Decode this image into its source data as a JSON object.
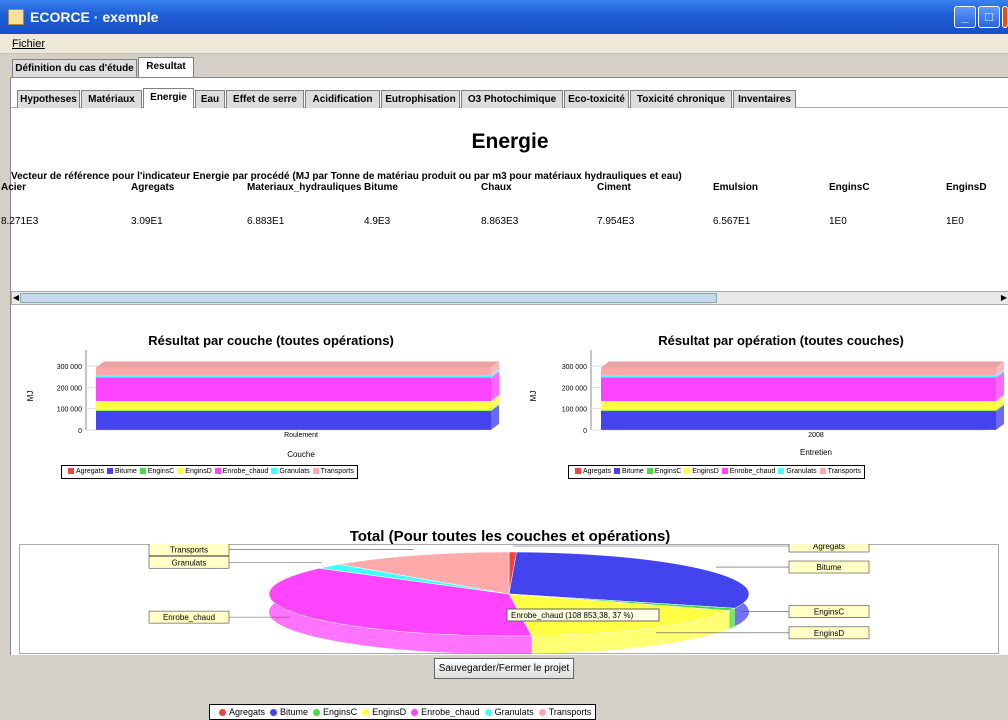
{
  "window": {
    "title": "ECORCE · exemple",
    "minimize": "_",
    "maximize": "□",
    "close": "X"
  },
  "menu": {
    "file": "Fichier"
  },
  "main_tabs": [
    "Définition du cas d'étude",
    "Resultat"
  ],
  "sub_tabs": [
    "Hypotheses",
    "Matériaux",
    "Energie",
    "Eau",
    "Effet de serre",
    "Acidification",
    "Eutrophisation",
    "O3 Photochimique",
    "Eco-toxicité",
    "Toxicité chronique",
    "Inventaires"
  ],
  "content": {
    "title": "Energie",
    "description": "Vecteur de référence pour l'indicateur Energie par procédé (MJ par Tonne de matériau produit ou par m3 pour matériaux hydrauliques et eau)",
    "headers": [
      "Acier",
      "Agregats",
      "Materiaux_hydrauliques",
      "Bitume",
      "Chaux",
      "Ciment",
      "Emulsion",
      "EnginsC",
      "EnginsD"
    ],
    "values": [
      "8.271E3",
      "3.09E1",
      "6.883E1",
      "4.9E3",
      "8.863E3",
      "7.954E3",
      "6.567E1",
      "1E0",
      "1E0"
    ]
  },
  "colors": {
    "Agregats": "#ee4444",
    "Bitume": "#4444ee",
    "EnginsC": "#44dd44",
    "EnginsD": "#ffff44",
    "Enrobe_chaud": "#ff44ff",
    "Granulats": "#44ffff",
    "Transports": "#ffaaaa"
  },
  "chart_data": [
    {
      "type": "bar",
      "title": "Résultat par couche (toutes opérations)",
      "categories": [
        "Roulement"
      ],
      "xlabel": "Couche",
      "ylabel": "MJ",
      "yticks": [
        "300 000",
        "200 000",
        "100 000",
        "0"
      ],
      "ylim": [
        0,
        300000
      ],
      "series": [
        {
          "name": "Agregats",
          "values": [
            1000
          ]
        },
        {
          "name": "Bitume",
          "values": [
            88000
          ]
        },
        {
          "name": "EnginsC",
          "values": [
            3000
          ]
        },
        {
          "name": "EnginsD",
          "values": [
            44000
          ]
        },
        {
          "name": "Enrobe_chaud",
          "values": [
            110000
          ]
        },
        {
          "name": "Granulats",
          "values": [
            10000
          ]
        },
        {
          "name": "Transports",
          "values": [
            37000
          ]
        }
      ],
      "legend": "bottom"
    },
    {
      "type": "bar",
      "title": "Résultat par opération (toutes couches)",
      "categories": [
        "2008"
      ],
      "category_sublabel": "Entretien",
      "ylabel": "MJ",
      "yticks": [
        "300 000",
        "200 000",
        "100 000",
        "0"
      ],
      "ylim": [
        0,
        300000
      ],
      "series": [
        {
          "name": "Agregats",
          "values": [
            1000
          ]
        },
        {
          "name": "Bitume",
          "values": [
            88000
          ]
        },
        {
          "name": "EnginsC",
          "values": [
            3000
          ]
        },
        {
          "name": "EnginsD",
          "values": [
            44000
          ]
        },
        {
          "name": "Enrobe_chaud",
          "values": [
            110000
          ]
        },
        {
          "name": "Granulats",
          "values": [
            10000
          ]
        },
        {
          "name": "Transports",
          "values": [
            37000
          ]
        }
      ],
      "legend": "bottom"
    },
    {
      "type": "pie",
      "title": "Total (Pour toutes les couches et opérations)",
      "labels": [
        "Agregats",
        "Bitume",
        "EnginsC",
        "EnginsD",
        "Enrobe_chaud",
        "Granulats",
        "Transports"
      ],
      "values": [
        0.5,
        30,
        1,
        17,
        37,
        2,
        12.5
      ],
      "tooltip": "Enrobe_chaud (108 853,38, 37 %)",
      "legend": "bottom"
    }
  ],
  "footer": {
    "save": "Sauvegarder/Fermer le projet"
  }
}
